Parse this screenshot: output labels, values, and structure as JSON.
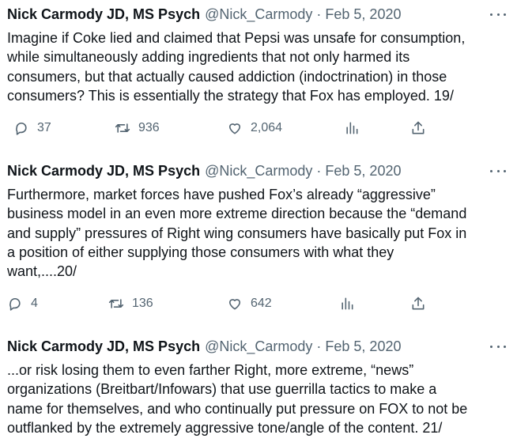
{
  "tweets": [
    {
      "name": "Nick Carmody JD, MS Psych",
      "handle": "@Nick_Carmody",
      "separator": "·",
      "date": "Feb 5, 2020",
      "text": "Imagine if Coke lied and claimed that Pepsi was unsafe for consumption,\nwhile simultaneously adding ingredients that not only harmed its\nconsumers, but that actually caused addiction (indoctrination) in those\nconsumers? This is essentially the strategy that Fox has employed.  19/",
      "replies": "37",
      "retweets": "936",
      "likes": "2,064"
    },
    {
      "name": "Nick Carmody JD, MS Psych",
      "handle": "@Nick_Carmody",
      "separator": "·",
      "date": "Feb 5, 2020",
      "text": "Furthermore, market forces have pushed Fox’s already “aggressive”\nbusiness model in an even more extreme direction because the “demand\nand supply” pressures of Right wing consumers have basically put Fox in\na position of either supplying those consumers with what they\nwant,....20/",
      "replies": "4",
      "retweets": "136",
      "likes": "642"
    },
    {
      "name": "Nick Carmody JD, MS Psych",
      "handle": "@Nick_Carmody",
      "separator": "·",
      "date": "Feb 5, 2020",
      "text": "...or risk losing them to even farther Right, more extreme, “news”\norganizations (Breitbart/Infowars) that use guerrilla tactics to make a\nname for themselves, and who continually put pressure on FOX to not be\noutflanked by the extremely aggressive tone/angle of the content.  21/"
    }
  ],
  "icons": {
    "reply": "reply-icon",
    "retweet": "retweet-icon",
    "like": "like-icon",
    "views": "views-icon",
    "share": "share-icon",
    "more": "more-icon"
  },
  "colors": {
    "text": "#0f1419",
    "muted": "#536471",
    "background": "#ffffff"
  }
}
